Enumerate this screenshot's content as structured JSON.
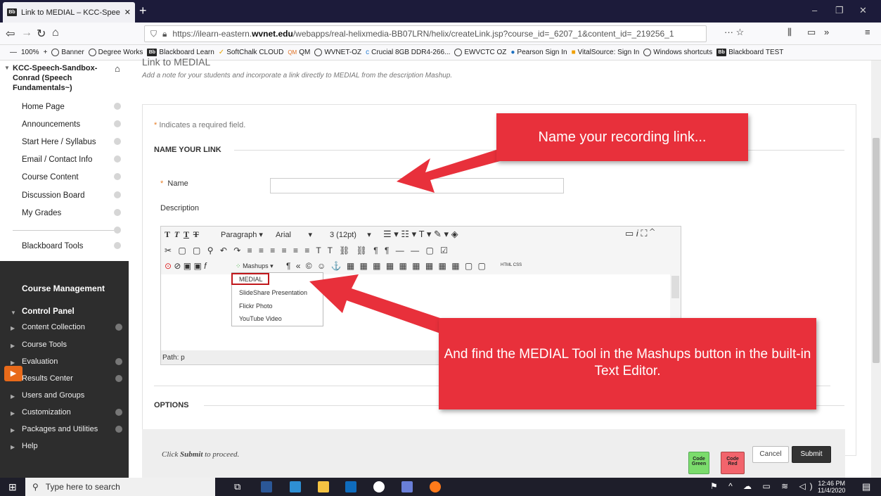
{
  "browser": {
    "tab_title": "Link to MEDIAL – KCC-Speech-",
    "url_prefix": "https://ilearn-eastern.",
    "url_domain": "wvnet.edu",
    "url_rest": "/webapps/real-helixmedia-BB07LRN/helix/createLink.jsp?course_id=_6207_1&content_id=_219256_1",
    "zoom": "100%",
    "bookmarks": [
      "Banner",
      "Degree Works",
      "Blackboard Learn",
      "SoftChalk CLOUD",
      "QM",
      "WVNET-OZ",
      "Crucial 8GB DDR4-266...",
      "EWVCTC OZ",
      "Pearson Sign In",
      "VitalSource: Sign In",
      "Windows shortcuts",
      "Blackboard TEST"
    ]
  },
  "sidebar": {
    "course_title": "KCC-Speech-Sandbox-Conrad (Speech Fundamentals~)",
    "items": [
      "Home Page",
      "Announcements",
      "Start Here / Syllabus",
      "Email / Contact Info",
      "Course Content",
      "Discussion Board",
      "My Grades",
      "Blackboard Tools"
    ],
    "management_title": "Course Management",
    "control_panel": "Control Panel",
    "cm_items": [
      "Content Collection",
      "Course Tools",
      "Evaluation",
      "Results Center",
      "Users and Groups",
      "Customization",
      "Packages and Utilities",
      "Help"
    ]
  },
  "main": {
    "title": "Link to MEDIAL",
    "subtitle": "Add a note for your students and incorporate a link directly to MEDIAL from the description Mashup.",
    "required_note": "Indicates a required field.",
    "required_star": "*",
    "section_name": "NAME YOUR LINK",
    "name_label": "Name",
    "description_label": "Description",
    "section_options": "OPTIONS",
    "submit_note_pre": "Click ",
    "submit_note_bold": "Submit",
    "submit_note_post": " to proceed.",
    "cancel": "Cancel",
    "submit": "Submit",
    "code_green": "Code Green",
    "code_red": "Code Red"
  },
  "editor": {
    "format": "Paragraph",
    "font": "Arial",
    "size": "3 (12pt)",
    "mashups": "Mashups",
    "path": "Path: p",
    "html_css": "HTML CSS",
    "mashup_items": [
      "MEDIAL",
      "SlideShare Presentation",
      "Flickr Photo",
      "YouTube Video"
    ]
  },
  "callouts": {
    "one": "Name your recording link...",
    "two": "And find the MEDIAL Tool in the Mashups button in the built-in Text Editor."
  },
  "taskbar": {
    "search": "Type here to search",
    "time": "12:46 PM",
    "date": "11/4/2020"
  },
  "colors": {
    "callout": "#e8303b",
    "submit": "#333333",
    "code_green": "#7bdc6c",
    "code_red": "#f2646c"
  }
}
